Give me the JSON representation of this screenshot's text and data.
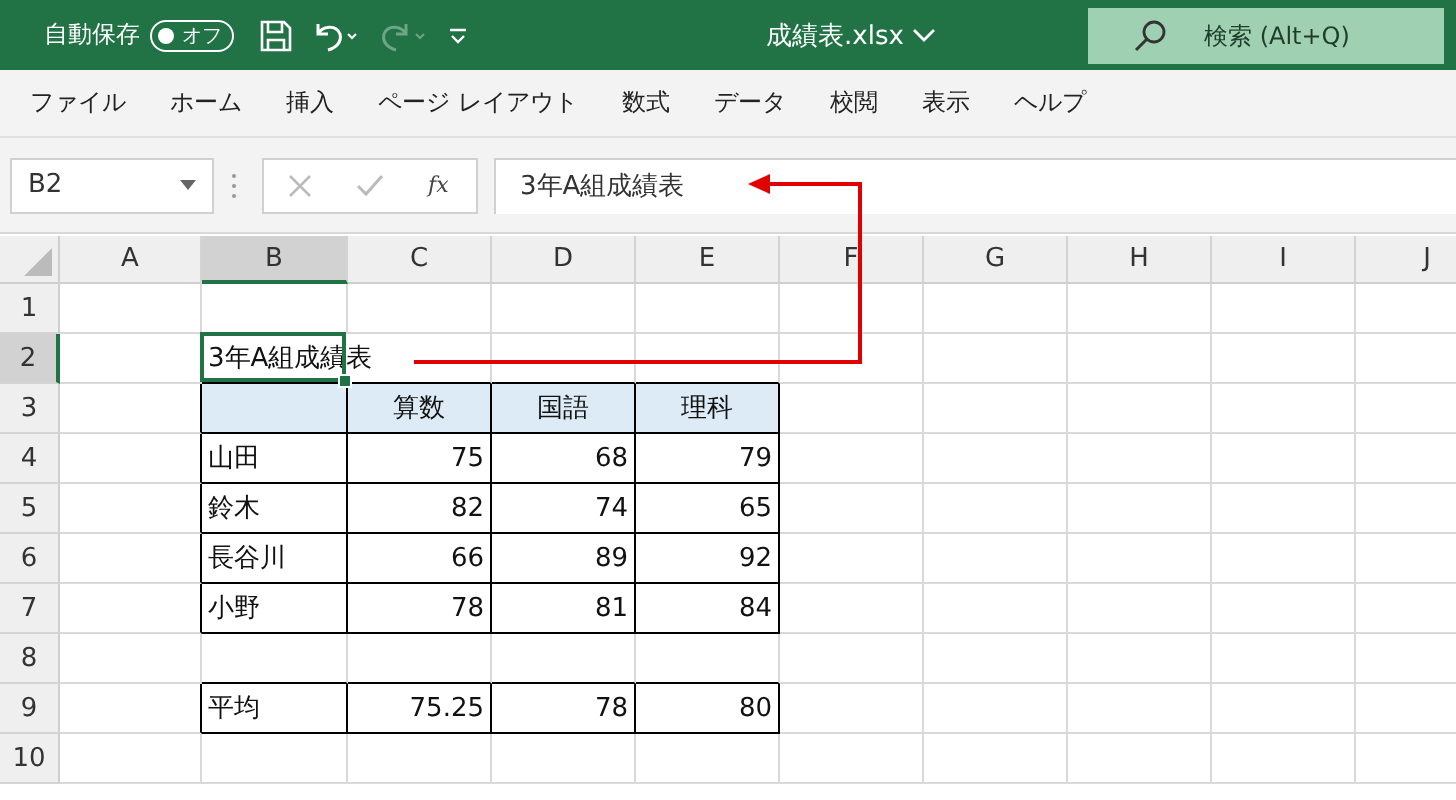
{
  "title_bar": {
    "autosave_label": "自動保存",
    "autosave": {
      "label": "オフ",
      "on": false
    },
    "redo_disabled": true,
    "filename": "成績表.xlsx",
    "search": {
      "placeholder": "検索 (Alt+Q)"
    }
  },
  "menu": [
    "ファイル",
    "ホーム",
    "挿入",
    "ページ レイアウト",
    "数式",
    "データ",
    "校閲",
    "表示",
    "ヘルプ"
  ],
  "formula_bar": {
    "name_box": "B2",
    "function_label": "fx",
    "value": "3年A組成績表"
  },
  "sheet": {
    "columns": [
      {
        "label": "A",
        "selected": false
      },
      {
        "label": "B",
        "selected": true
      },
      {
        "label": "C",
        "selected": false
      },
      {
        "label": "D",
        "selected": false
      },
      {
        "label": "E",
        "selected": false
      },
      {
        "label": "F",
        "selected": false
      },
      {
        "label": "G",
        "selected": false
      },
      {
        "label": "H",
        "selected": false
      },
      {
        "label": "I",
        "selected": false
      },
      {
        "label": "J",
        "selected": false
      }
    ],
    "rows": [
      {
        "label": "1",
        "selected": false,
        "kind": "blank"
      },
      {
        "label": "2",
        "selected": true,
        "kind": "title",
        "cells": [
          null,
          "3年A組成績表"
        ]
      },
      {
        "label": "3",
        "selected": false,
        "kind": "header",
        "cells": [
          null,
          null,
          "算数",
          "国語",
          "理科"
        ]
      },
      {
        "label": "4",
        "selected": false,
        "kind": "data",
        "cells": [
          null,
          "山田",
          "75",
          "68",
          "79"
        ]
      },
      {
        "label": "5",
        "selected": false,
        "kind": "data",
        "cells": [
          null,
          "鈴木",
          "82",
          "74",
          "65"
        ]
      },
      {
        "label": "6",
        "selected": false,
        "kind": "data",
        "cells": [
          null,
          "長谷川",
          "66",
          "89",
          "92"
        ]
      },
      {
        "label": "7",
        "selected": false,
        "kind": "data",
        "cells": [
          null,
          "小野",
          "78",
          "81",
          "84"
        ]
      },
      {
        "label": "8",
        "selected": false,
        "kind": "blank"
      },
      {
        "label": "9",
        "selected": false,
        "kind": "data",
        "cells": [
          null,
          "平均",
          "75.25",
          "78",
          "80"
        ]
      },
      {
        "label": "10",
        "selected": false,
        "kind": "blank"
      }
    ]
  }
}
